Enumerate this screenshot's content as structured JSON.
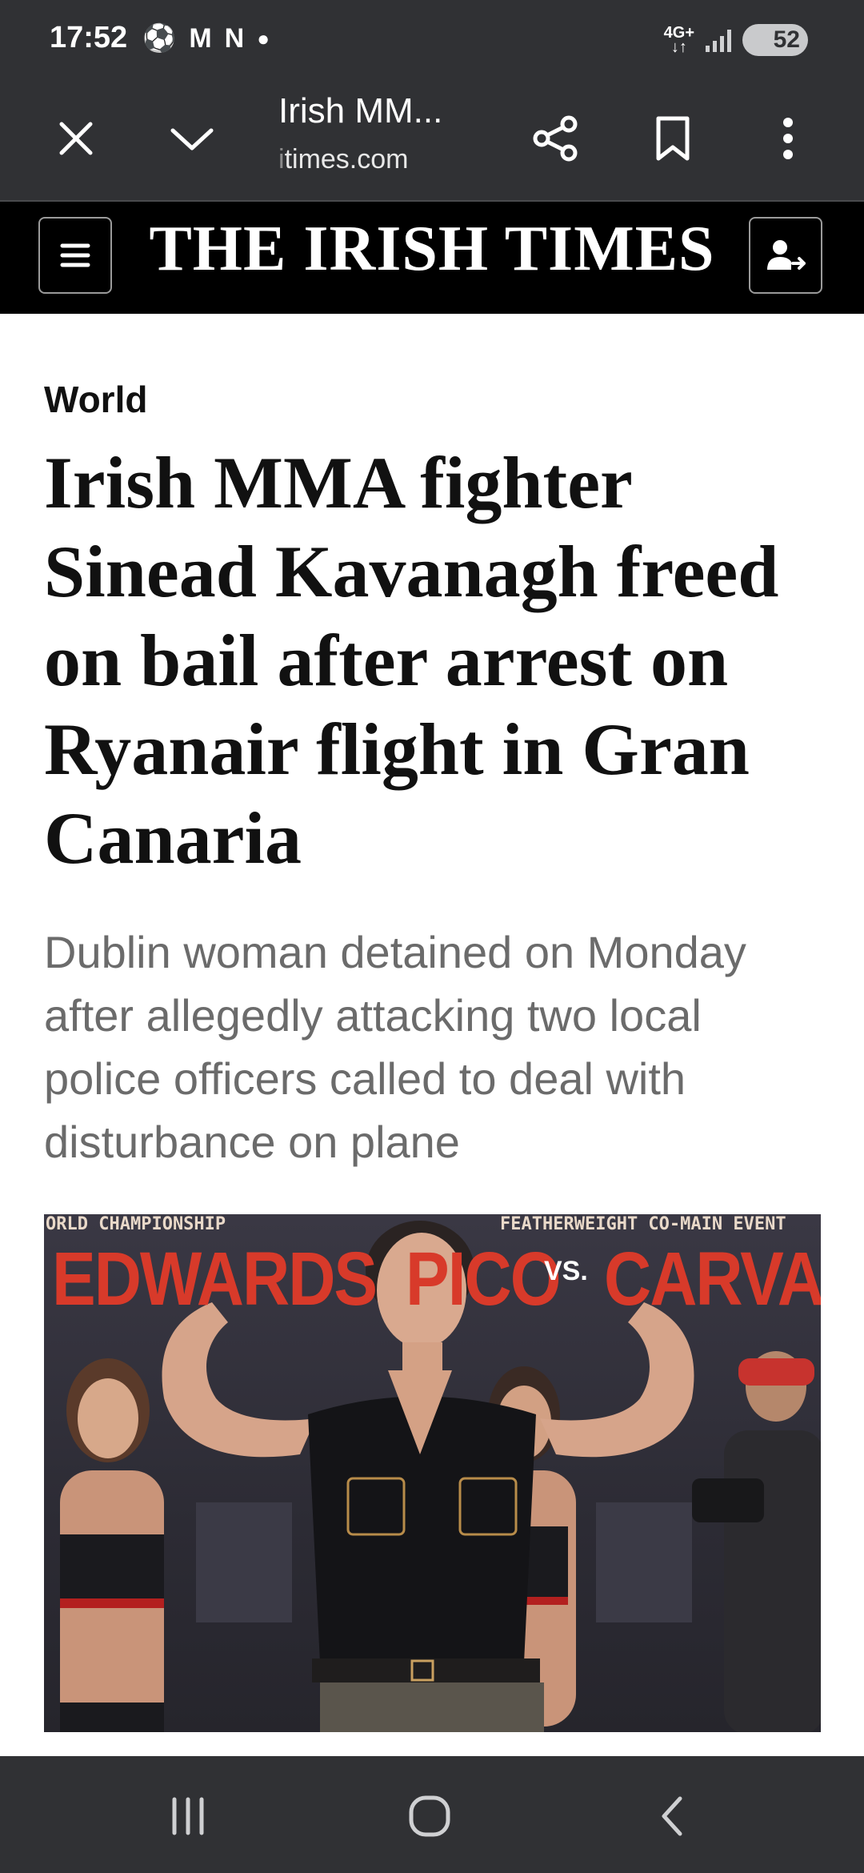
{
  "status_bar": {
    "time": "17:52",
    "left_icons": [
      "soccer-ball-icon",
      "gmail-icon",
      "netflix-icon",
      "dot-icon"
    ],
    "network": "4G+",
    "battery": "52"
  },
  "browser_bar": {
    "tab_title": "Irish MM...",
    "url": "times.com",
    "url_fade_prefix": "i"
  },
  "masthead": {
    "title": "THE IRISH TIMES"
  },
  "article": {
    "section": "World",
    "headline": "Irish MMA fighter Sinead Kavanagh freed on bail after arrest on Ryanair flight in Gran Canaria",
    "subheadline": "Dublin woman detained on Monday after allegedly attacking two local police officers called to deal with disturbance on plane",
    "photo": {
      "banner_left_small": "ORLD CHAMPIONSHIP",
      "banner_left_big": "EDWARDS",
      "banner_right_small": "FEATHERWEIGHT CO-MAIN EVENT",
      "banner_right_big_1": "PICO",
      "banner_vs": "VS.",
      "banner_right_big_2": "CARVALH"
    }
  },
  "colors": {
    "system_bar": "#303134",
    "masthead": "#000000",
    "subhead_text": "#6b6b6b",
    "banner_red": "#d83a2a"
  }
}
